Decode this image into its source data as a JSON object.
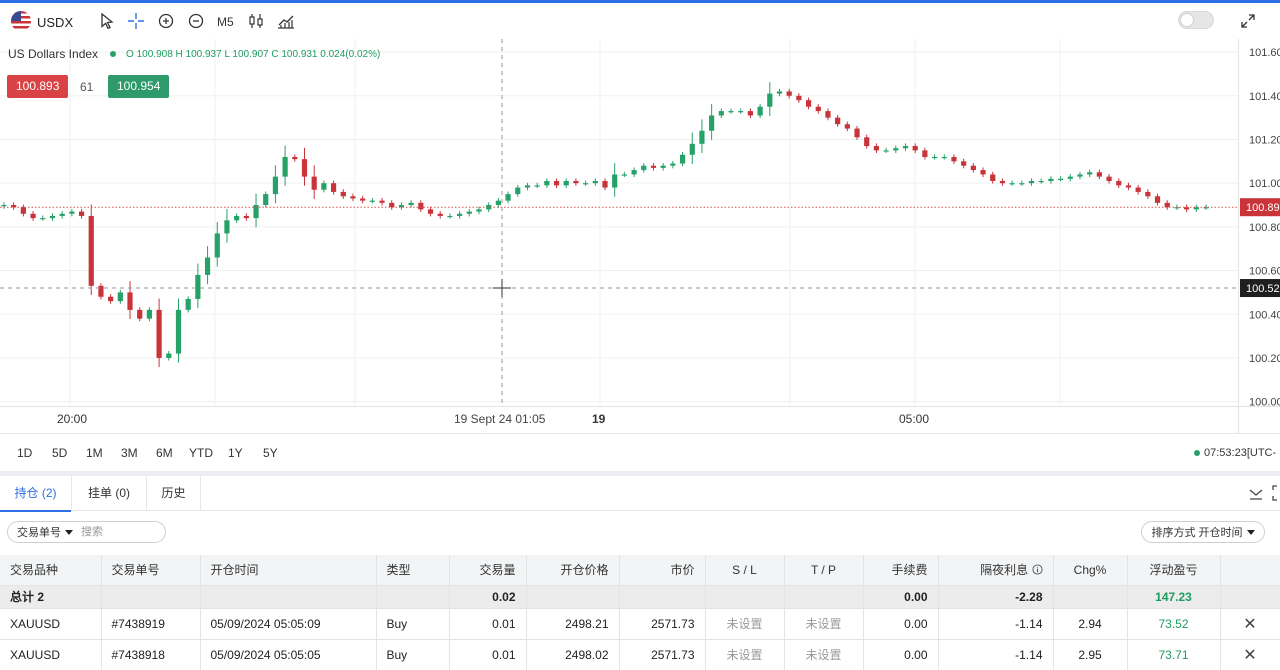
{
  "toolbar": {
    "symbol": "USDX",
    "timeframe": "M5",
    "icons": [
      "cursor-icon",
      "crosshair-icon",
      "zoom-in-icon",
      "zoom-out-icon",
      "candles-icon",
      "indicators-icon",
      "toggle-switch",
      "expand-icon"
    ]
  },
  "legend": {
    "name": "US Dollars Index",
    "ohlc": "O 100.908  H 100.937  L 100.907  C 100.931  0.024(0.02%)"
  },
  "quote": {
    "bid": "100.893",
    "spread": "61",
    "ask": "100.954"
  },
  "colors": {
    "up": "#26a269",
    "down": "#c8343a",
    "accent": "#2f6fe4",
    "bid_box": "#d94346",
    "ask_box": "#2f9b6b"
  },
  "chart_data": {
    "type": "candlestick",
    "y_ticks": [
      "101.600",
      "101.400",
      "101.200",
      "101.000",
      "100.800",
      "100.600",
      "100.400",
      "100.200",
      "100.000"
    ],
    "ylim": [
      99.98,
      101.66
    ],
    "x_labels": [
      "20:00",
      "19",
      "05:00"
    ],
    "crosshair_time": "19 Sept 24 01:05",
    "current_price_label": "100.89",
    "crosshair_price_label": "100.52",
    "closes": [
      100.9,
      100.89,
      100.86,
      100.84,
      100.84,
      100.85,
      100.86,
      100.87,
      100.85,
      100.53,
      100.48,
      100.46,
      100.5,
      100.42,
      100.38,
      100.42,
      100.2,
      100.22,
      100.42,
      100.47,
      100.58,
      100.66,
      100.77,
      100.83,
      100.85,
      100.84,
      100.9,
      100.95,
      101.03,
      101.12,
      101.11,
      101.03,
      100.97,
      101.0,
      100.96,
      100.94,
      100.93,
      100.92,
      100.92,
      100.91,
      100.89,
      100.9,
      100.91,
      100.88,
      100.86,
      100.85,
      100.85,
      100.86,
      100.87,
      100.88,
      100.9,
      100.92,
      100.95,
      100.98,
      100.99,
      100.99,
      101.01,
      100.99,
      101.01,
      101.0,
      101.0,
      101.01,
      100.98,
      101.04,
      101.04,
      101.06,
      101.08,
      101.07,
      101.08,
      101.09,
      101.13,
      101.18,
      101.24,
      101.31,
      101.33,
      101.33,
      101.33,
      101.31,
      101.35,
      101.41,
      101.42,
      101.4,
      101.38,
      101.35,
      101.33,
      101.3,
      101.27,
      101.25,
      101.21,
      101.17,
      101.15,
      101.15,
      101.16,
      101.17,
      101.15,
      101.12,
      101.12,
      101.12,
      101.1,
      101.08,
      101.06,
      101.04,
      101.01,
      101.0,
      101.0,
      101.0,
      101.01,
      101.01,
      101.02,
      101.02,
      101.03,
      101.04,
      101.05,
      101.03,
      101.01,
      100.99,
      100.98,
      100.96,
      100.94,
      100.91,
      100.89,
      100.89,
      100.88,
      100.89,
      100.89
    ]
  },
  "ranges": [
    "1D",
    "5D",
    "1M",
    "3M",
    "6M",
    "YTD",
    "1Y",
    "5Y"
  ],
  "clock": "07:53:23[UTC-",
  "tabs": {
    "positions": "持仓 (2)",
    "orders": "挂单 (0)",
    "history": "历史"
  },
  "filter": {
    "select_label": "交易单号",
    "placeholder": "搜索"
  },
  "sort": {
    "label": "排序方式 开仓时间"
  },
  "table": {
    "headers": [
      "交易品种",
      "交易单号",
      "开仓时间",
      "类型",
      "交易量",
      "开仓价格",
      "市价",
      "S / L",
      "T / P",
      "手续费",
      "隔夜利息",
      "Chg%",
      "浮动盈亏"
    ],
    "total": {
      "label": "总计 2",
      "volume": "0.02",
      "fee": "0.00",
      "swap": "-2.28",
      "pnl": "147.23"
    },
    "rows": [
      {
        "symbol": "XAUUSD",
        "ticket": "#7438919",
        "time": "05/09/2024 05:05:09",
        "type": "Buy",
        "volume": "0.01",
        "open": "2498.21",
        "market": "2571.73",
        "sl": "未设置",
        "tp": "未设置",
        "fee": "0.00",
        "swap": "-1.14",
        "chg": "2.94",
        "pnl": "73.52"
      },
      {
        "symbol": "XAUUSD",
        "ticket": "#7438918",
        "time": "05/09/2024 05:05:05",
        "type": "Buy",
        "volume": "0.01",
        "open": "2498.02",
        "market": "2571.73",
        "sl": "未设置",
        "tp": "未设置",
        "fee": "0.00",
        "swap": "-1.14",
        "chg": "2.95",
        "pnl": "73.71"
      }
    ]
  }
}
